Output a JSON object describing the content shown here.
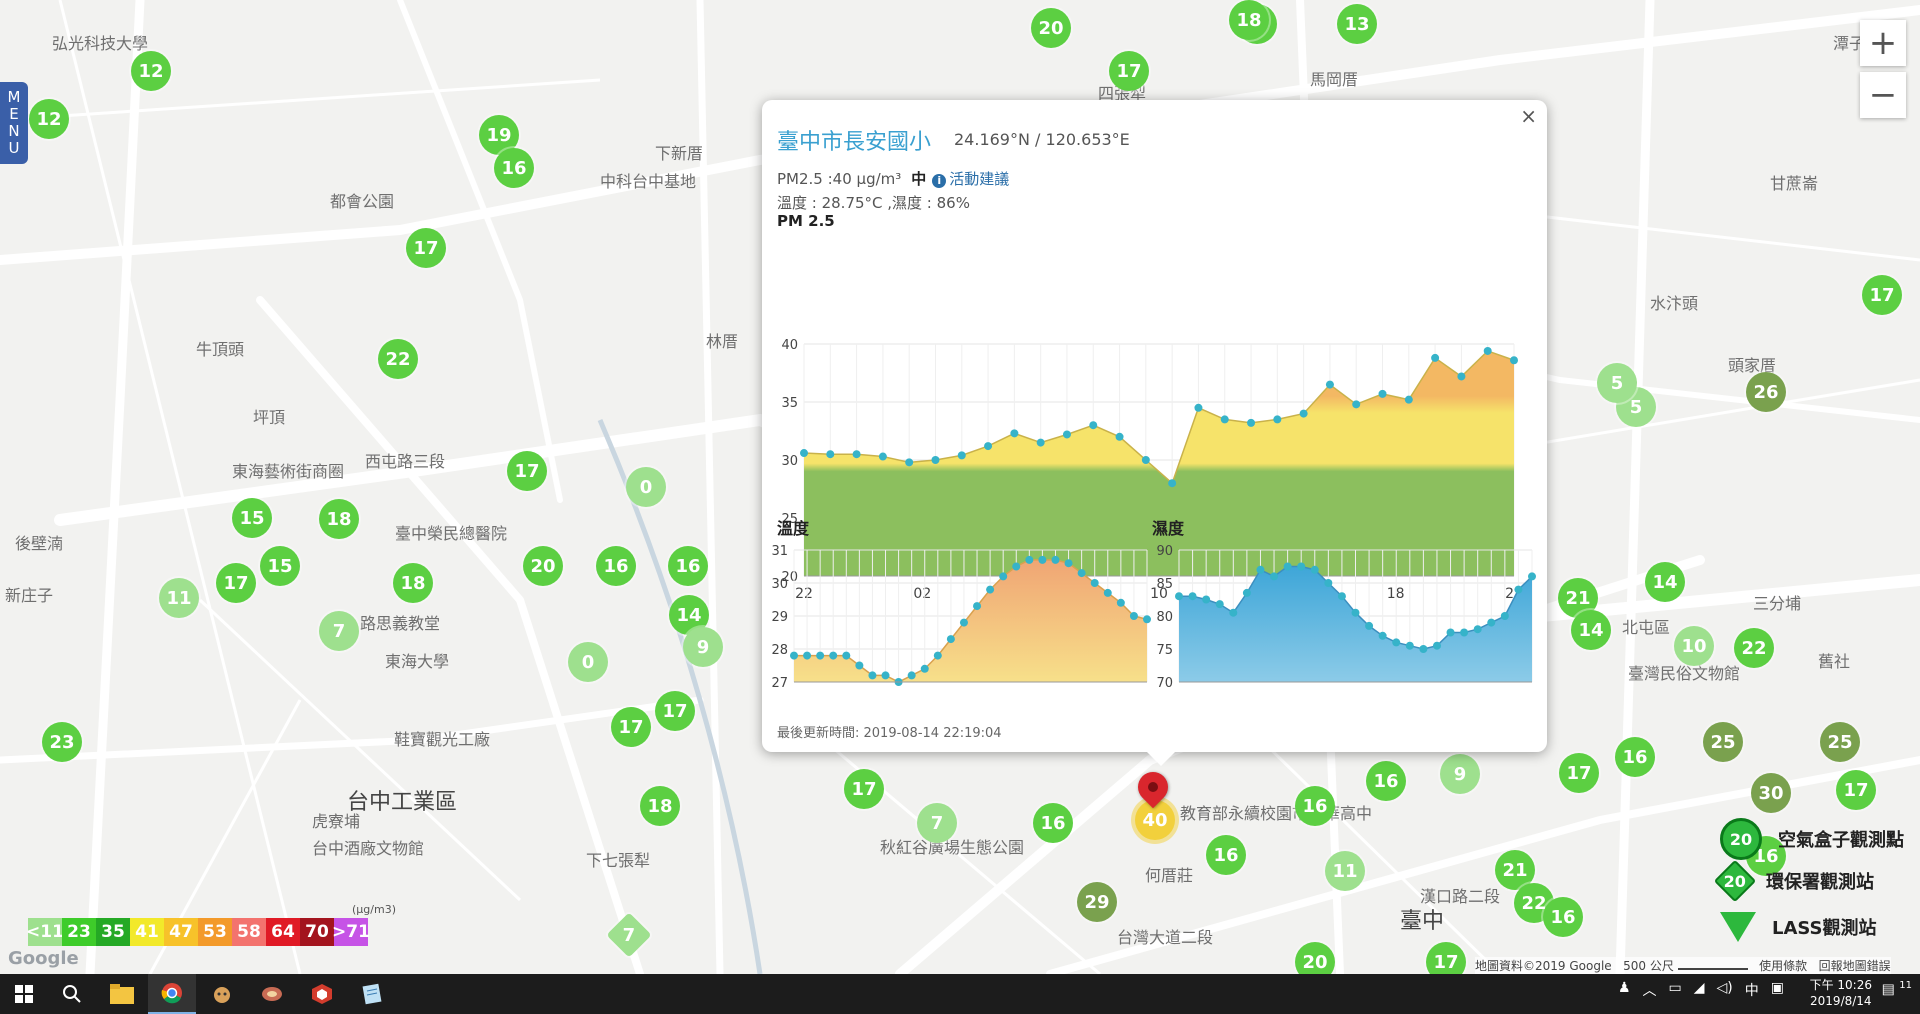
{
  "map": {
    "menu_label": [
      "M",
      "E",
      "N",
      "U"
    ],
    "zoom_in": "+",
    "zoom_out": "−",
    "places": [
      {
        "text": "弘光科技大學"
      },
      {
        "text": "都會公園"
      },
      {
        "text": "中科台中基地"
      },
      {
        "text": "下新厝"
      },
      {
        "text": "牛頂頭"
      },
      {
        "text": "坪頂"
      },
      {
        "text": "東海藝術街商圈"
      },
      {
        "text": "臺中榮民總醫院"
      },
      {
        "text": "後壁湳"
      },
      {
        "text": "新庄子"
      },
      {
        "text": "路思義教堂"
      },
      {
        "text": "東海大學"
      },
      {
        "text": "鞋寶觀光工廠"
      },
      {
        "text": "台中工業區"
      },
      {
        "text": "虎寮埔"
      },
      {
        "text": "台中酒廠文物館"
      },
      {
        "text": "下七張犁"
      },
      {
        "text": "周厝"
      },
      {
        "text": "林厝"
      },
      {
        "text": "馬岡厝"
      },
      {
        "text": "水汴頭"
      },
      {
        "text": "頭家厝"
      },
      {
        "text": "甘蔗崙"
      },
      {
        "text": "北屯區"
      },
      {
        "text": "三分埔"
      },
      {
        "text": "舊社"
      },
      {
        "text": "何厝莊"
      },
      {
        "text": "臺中"
      },
      {
        "text": "四張犁"
      },
      {
        "text": "潭子"
      },
      {
        "text": "臺灣民俗文物館"
      },
      {
        "text": "教育部永續校園市文華高中"
      },
      {
        "text": "秋紅谷廣場生態公園"
      },
      {
        "text": "西屯路三段"
      },
      {
        "text": "台灣大道二段"
      },
      {
        "text": "漢口路二段"
      }
    ],
    "markers": [
      {
        "v": "12",
        "c": "#5ccf42"
      },
      {
        "v": "12",
        "c": "#5ccf42"
      },
      {
        "v": "19",
        "c": "#5ccf42"
      },
      {
        "v": "16",
        "c": "#5ccf42"
      },
      {
        "v": "17",
        "c": "#5ccf42"
      },
      {
        "v": "22",
        "c": "#5ccf42"
      },
      {
        "v": "17",
        "c": "#5ccf42"
      },
      {
        "v": "0",
        "c": "#9ee08e"
      },
      {
        "v": "15",
        "c": "#5ccf42"
      },
      {
        "v": "18",
        "c": "#5ccf42"
      },
      {
        "v": "17",
        "c": "#5ccf42"
      },
      {
        "v": "15",
        "c": "#5ccf42"
      },
      {
        "v": "11",
        "c": "#9ee08e"
      },
      {
        "v": "7",
        "c": "#9ee08e"
      },
      {
        "v": "18",
        "c": "#5ccf42"
      },
      {
        "v": "20",
        "c": "#5ccf42"
      },
      {
        "v": "16",
        "c": "#5ccf42"
      },
      {
        "v": "16",
        "c": "#5ccf42"
      },
      {
        "v": "14",
        "c": "#5ccf42"
      },
      {
        "v": "9",
        "c": "#9ee08e"
      },
      {
        "v": "0",
        "c": "#9ee08e"
      },
      {
        "v": "17",
        "c": "#5ccf42"
      },
      {
        "v": "17",
        "c": "#5ccf42"
      },
      {
        "v": "23",
        "c": "#5ccf42"
      },
      {
        "v": "18",
        "c": "#5ccf42"
      },
      {
        "v": "17",
        "c": "#5ccf42"
      },
      {
        "v": "7",
        "c": "#9ee08e"
      },
      {
        "v": "16",
        "c": "#5ccf42"
      },
      {
        "v": "40",
        "c": "#f2d03c"
      },
      {
        "v": "29",
        "c": "#7aa14e"
      },
      {
        "v": "16",
        "c": "#5ccf42"
      },
      {
        "v": "16",
        "c": "#5ccf42"
      },
      {
        "v": "16",
        "c": "#5ccf42"
      },
      {
        "v": "9",
        "c": "#9ee08e"
      },
      {
        "v": "11",
        "c": "#9ee08e"
      },
      {
        "v": "21",
        "c": "#5ccf42"
      },
      {
        "v": "22",
        "c": "#5ccf42"
      },
      {
        "v": "16",
        "c": "#5ccf42"
      },
      {
        "v": "17",
        "c": "#5ccf42"
      },
      {
        "v": "16",
        "c": "#5ccf42"
      },
      {
        "v": "25",
        "c": "#7aa14e"
      },
      {
        "v": "25",
        "c": "#7aa14e"
      },
      {
        "v": "30",
        "c": "#7aa14e"
      },
      {
        "v": "17",
        "c": "#5ccf42"
      },
      {
        "v": "21",
        "c": "#5ccf42"
      },
      {
        "v": "14",
        "c": "#5ccf42"
      },
      {
        "v": "14",
        "c": "#5ccf42"
      },
      {
        "v": "10",
        "c": "#9ee08e"
      },
      {
        "v": "22",
        "c": "#5ccf42"
      },
      {
        "v": "26",
        "c": "#7aa14e"
      },
      {
        "v": "5",
        "c": "#9ee08e"
      },
      {
        "v": "17",
        "c": "#5ccf42"
      },
      {
        "v": "20",
        "c": "#5ccf42"
      },
      {
        "v": "17",
        "c": "#5ccf42"
      },
      {
        "v": "13",
        "c": "#5ccf42"
      },
      {
        "v": "17",
        "c": "#5ccf42"
      },
      {
        "v": "5",
        "c": "#9ee08e"
      },
      {
        "v": "20",
        "c": "#5ccf42"
      },
      {
        "v": "17",
        "c": "#5ccf42"
      },
      {
        "v": "18",
        "c": "#5ccf42"
      },
      {
        "v": "7",
        "c": "#9ee08e",
        "diamond": true
      },
      {
        "v": "16",
        "c": "#5ccf42"
      }
    ]
  },
  "popup": {
    "close_label": "×",
    "station_name": "臺中市長安國小",
    "coords": "24.169°N / 120.653°E",
    "pm_text": "PM2.5 :40 μg/m³",
    "level": "中",
    "advice_icon": "i",
    "advice_link": "活動建議",
    "env_text": "溫度 : 28.75°C ,濕度 : 86%",
    "pm_chart_title": "PM 2.5",
    "temp_chart_title": "溫度",
    "hum_chart_title": "濕度",
    "updated": "最後更新時間: 2019-08-14 22:19:04"
  },
  "chart_data": [
    {
      "type": "area",
      "title": "PM 2.5",
      "ylim": [
        20,
        40
      ],
      "yticks": [
        20,
        25,
        30,
        35,
        40
      ],
      "x_tick_labels": [
        "22",
        "02",
        "06",
        "10",
        "14",
        "18",
        "22"
      ],
      "values": [
        30.6,
        30.5,
        30.5,
        30.3,
        29.8,
        30.0,
        30.4,
        31.2,
        32.3,
        31.5,
        32.2,
        33.0,
        32.0,
        30.0,
        28.0,
        34.5,
        33.5,
        33.2,
        33.5,
        34.0,
        36.5,
        34.8,
        35.7,
        35.2,
        38.8,
        37.2,
        39.4,
        38.6
      ],
      "band_colors": {
        "good": "#8cbf5e",
        "moderate": "#f6e36a",
        "unhealthy_sensitive": "#f3b863"
      }
    },
    {
      "type": "area",
      "title": "溫度",
      "ylim": [
        27,
        31
      ],
      "yticks": [
        27,
        28,
        29,
        30,
        31
      ],
      "values": [
        27.8,
        27.8,
        27.8,
        27.8,
        27.8,
        27.5,
        27.2,
        27.2,
        27.0,
        27.2,
        27.4,
        27.8,
        28.3,
        28.8,
        29.3,
        29.8,
        30.2,
        30.5,
        30.7,
        30.7,
        30.7,
        30.6,
        30.3,
        30.0,
        29.7,
        29.4,
        29.0,
        28.9
      ],
      "color": "#f2bf82"
    },
    {
      "type": "area",
      "title": "濕度",
      "ylim": [
        70,
        90
      ],
      "yticks": [
        70,
        75,
        80,
        85,
        90
      ],
      "values": [
        83,
        83,
        82.5,
        81.8,
        80.5,
        83.5,
        87,
        86,
        87.5,
        87.5,
        87,
        85,
        83,
        80.5,
        78.5,
        77,
        76,
        75.5,
        75,
        75.5,
        77.5,
        77.5,
        78,
        79,
        80,
        84,
        86
      ],
      "color": "#5eb3de"
    }
  ],
  "legend": {
    "unit": "(μg/m3)",
    "bins": [
      {
        "label": "<11",
        "color": "#9ee08e"
      },
      {
        "label": "23",
        "color": "#3ecc2a"
      },
      {
        "label": "35",
        "color": "#25a925"
      },
      {
        "label": "41",
        "color": "#f2e92a"
      },
      {
        "label": "47",
        "color": "#f7c22a"
      },
      {
        "label": "53",
        "color": "#f39a2a"
      },
      {
        "label": "58",
        "color": "#f3736e"
      },
      {
        "label": "64",
        "color": "#e01a25"
      },
      {
        "label": "70",
        "color": "#a3141e"
      },
      {
        "label": ">71",
        "color": "#c653e6"
      }
    ]
  },
  "station_types": [
    {
      "label": "空氣盒子觀測點",
      "badge": "20"
    },
    {
      "label": "環保署觀測站",
      "badge": "20"
    },
    {
      "label": "LASS觀測站",
      "badge": "20"
    }
  ],
  "attribution": {
    "google_logo": "Google",
    "map_data": "地圖資料©2019 Google",
    "scale": "500 公尺",
    "terms": "使用條款",
    "report": "回報地圖錯誤"
  },
  "taskbar": {
    "time": "下午 10:26",
    "date": "2019/8/14",
    "ime": "中",
    "notifications": "11",
    "apps": [
      "windows-start",
      "search",
      "file-explorer",
      "chrome",
      "app-kitty",
      "app-dragon",
      "app-sketchup",
      "app-notepad"
    ]
  }
}
